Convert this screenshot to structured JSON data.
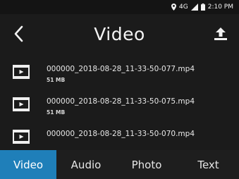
{
  "status_bar": {
    "network": "4G",
    "time": "2:10 PM",
    "icons": [
      "location-icon",
      "signal-icon",
      "battery-icon"
    ]
  },
  "header": {
    "title": "Video",
    "back_icon": "chevron-left-icon",
    "upload_icon": "upload-icon"
  },
  "files": [
    {
      "name": "000000_2018-08-28_11-33-50-077.mp4",
      "size": "51 MB",
      "icon": "video-file-icon"
    },
    {
      "name": "000000_2018-08-28_11-33-50-075.mp4",
      "size": "51 MB",
      "icon": "video-file-icon"
    },
    {
      "name": "000000_2018-08-28_11-33-50-070.mp4",
      "size": "",
      "icon": "video-file-icon"
    }
  ],
  "tabs": [
    {
      "label": "Video",
      "active": true
    },
    {
      "label": "Audio",
      "active": false
    },
    {
      "label": "Photo",
      "active": false
    },
    {
      "label": "Text",
      "active": false
    }
  ],
  "colors": {
    "accent": "#1f7fb9",
    "background": "#1b1b1b"
  }
}
